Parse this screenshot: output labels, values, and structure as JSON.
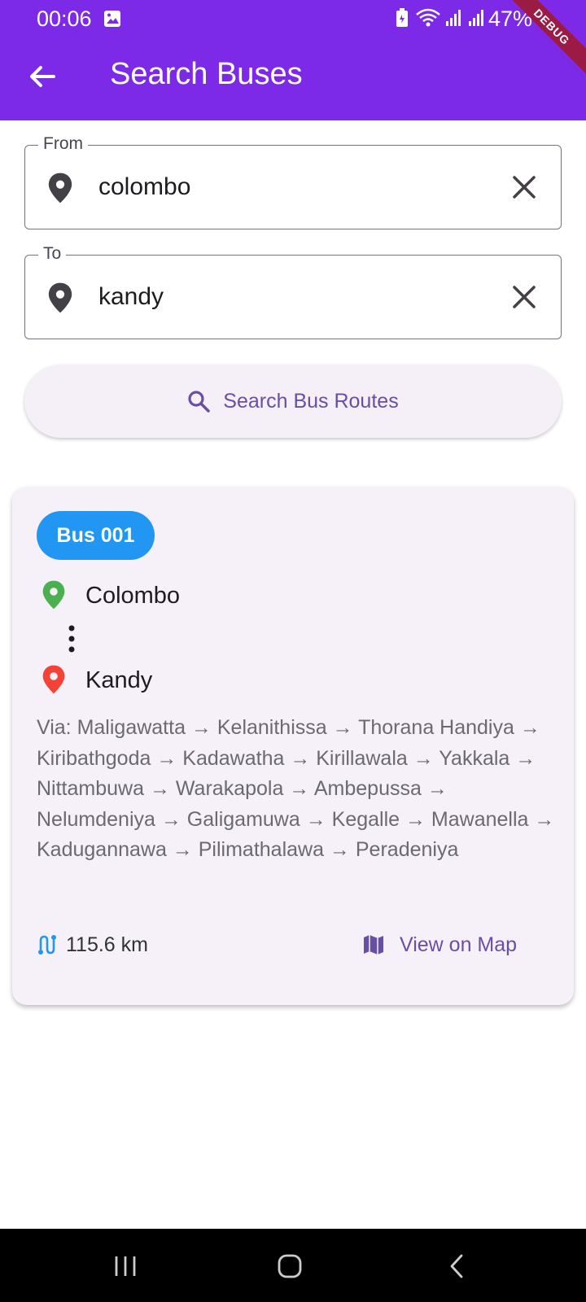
{
  "status_bar": {
    "time": "00:06",
    "battery": "47%"
  },
  "debug_banner": "DEBUG",
  "app_bar": {
    "title": "Search Buses"
  },
  "from_field": {
    "label": "From",
    "value": "colombo"
  },
  "to_field": {
    "label": "To",
    "value": "kandy"
  },
  "search_button": {
    "label": "Search Bus Routes"
  },
  "route_card": {
    "bus_number": "Bus 001",
    "origin": "Colombo",
    "destination": "Kandy",
    "via": "Via: Maligawatta → Kelanithissa → Thorana Handiya → Kiribathgoda → Kadawatha → Kirillawala → Yakkala → Nittambuwa → Warakapola → Ambepussa → Nelumdeniya → Galigamuwa → Kegalle → Mawanella → Kadugannawa → Pilimathalawa → Peradeniya",
    "distance": "115.6 km",
    "map_label": "View on Map"
  },
  "colors": {
    "app_bar": "#7c2ae8",
    "accent": "#6750a4",
    "badge": "#2196f3",
    "origin_pin": "#4caf50",
    "destination_pin": "#f44336"
  }
}
